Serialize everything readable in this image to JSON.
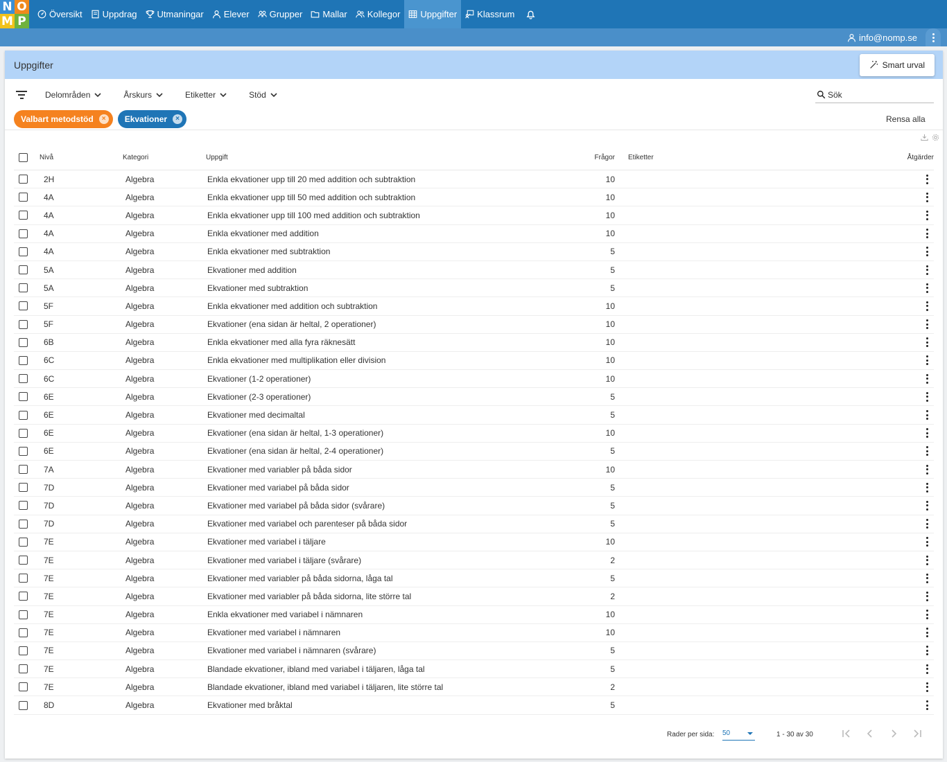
{
  "logo": {
    "letters": [
      "N",
      "O",
      "M",
      "P"
    ]
  },
  "nav": {
    "items": [
      {
        "label": "Översikt",
        "icon": "dashboard-icon",
        "active": false
      },
      {
        "label": "Uppdrag",
        "icon": "book-icon",
        "active": false
      },
      {
        "label": "Utmaningar",
        "icon": "trophy-icon",
        "active": false
      },
      {
        "label": "Elever",
        "icon": "user-icon",
        "active": false
      },
      {
        "label": "Grupper",
        "icon": "group-icon",
        "active": false
      },
      {
        "label": "Mallar",
        "icon": "folder-icon",
        "active": false
      },
      {
        "label": "Kollegor",
        "icon": "colleagues-icon",
        "active": false
      },
      {
        "label": "Uppgifter",
        "icon": "grid-icon",
        "active": true
      },
      {
        "label": "Klassrum",
        "icon": "classroom-icon",
        "active": false
      }
    ],
    "bell_icon": "bell-icon"
  },
  "user": {
    "email": "info@nomp.se"
  },
  "page": {
    "title": "Uppgifter",
    "smart_button": "Smart urval"
  },
  "filters": {
    "dropdowns": [
      "Delområden",
      "Årskurs",
      "Etiketter",
      "Stöd"
    ],
    "search_placeholder": "Sök",
    "chips": [
      {
        "label": "Valbart metodstöd",
        "color": "#f5821f"
      },
      {
        "label": "Ekvationer",
        "color": "#1f75b6"
      }
    ],
    "clear_all": "Rensa alla"
  },
  "table": {
    "headers": {
      "niva": "Nivå",
      "kategori": "Kategori",
      "uppgift": "Uppgift",
      "fragor": "Frågor",
      "etiketter": "Etiketter",
      "atgarder": "Åtgärder"
    },
    "rows": [
      {
        "niva": "2H",
        "kategori": "Algebra",
        "uppgift": "Enkla ekvationer upp till 20 med addition och subtraktion",
        "fragor": "10",
        "etiketter": ""
      },
      {
        "niva": "4A",
        "kategori": "Algebra",
        "uppgift": "Enkla ekvationer upp till 50 med addition och subtraktion",
        "fragor": "10",
        "etiketter": ""
      },
      {
        "niva": "4A",
        "kategori": "Algebra",
        "uppgift": "Enkla ekvationer upp till 100 med addition och subtraktion",
        "fragor": "10",
        "etiketter": ""
      },
      {
        "niva": "4A",
        "kategori": "Algebra",
        "uppgift": "Enkla ekvationer med addition",
        "fragor": "10",
        "etiketter": ""
      },
      {
        "niva": "4A",
        "kategori": "Algebra",
        "uppgift": "Enkla ekvationer med subtraktion",
        "fragor": "5",
        "etiketter": ""
      },
      {
        "niva": "5A",
        "kategori": "Algebra",
        "uppgift": "Ekvationer med addition",
        "fragor": "5",
        "etiketter": ""
      },
      {
        "niva": "5A",
        "kategori": "Algebra",
        "uppgift": "Ekvationer med subtraktion",
        "fragor": "5",
        "etiketter": ""
      },
      {
        "niva": "5F",
        "kategori": "Algebra",
        "uppgift": "Enkla ekvationer med addition och subtraktion",
        "fragor": "10",
        "etiketter": ""
      },
      {
        "niva": "5F",
        "kategori": "Algebra",
        "uppgift": "Ekvationer (ena sidan är heltal, 2 operationer)",
        "fragor": "10",
        "etiketter": ""
      },
      {
        "niva": "6B",
        "kategori": "Algebra",
        "uppgift": "Enkla ekvationer med alla fyra räknesätt",
        "fragor": "10",
        "etiketter": ""
      },
      {
        "niva": "6C",
        "kategori": "Algebra",
        "uppgift": "Enkla ekvationer med multiplikation eller division",
        "fragor": "10",
        "etiketter": ""
      },
      {
        "niva": "6C",
        "kategori": "Algebra",
        "uppgift": "Ekvationer (1-2 operationer)",
        "fragor": "10",
        "etiketter": ""
      },
      {
        "niva": "6E",
        "kategori": "Algebra",
        "uppgift": "Ekvationer (2-3 operationer)",
        "fragor": "5",
        "etiketter": ""
      },
      {
        "niva": "6E",
        "kategori": "Algebra",
        "uppgift": "Ekvationer med decimaltal",
        "fragor": "5",
        "etiketter": ""
      },
      {
        "niva": "6E",
        "kategori": "Algebra",
        "uppgift": "Ekvationer (ena sidan är heltal, 1-3 operationer)",
        "fragor": "10",
        "etiketter": ""
      },
      {
        "niva": "6E",
        "kategori": "Algebra",
        "uppgift": "Ekvationer (ena sidan är heltal, 2-4 operationer)",
        "fragor": "5",
        "etiketter": ""
      },
      {
        "niva": "7A",
        "kategori": "Algebra",
        "uppgift": "Ekvationer med variabler på båda sidor",
        "fragor": "10",
        "etiketter": ""
      },
      {
        "niva": "7D",
        "kategori": "Algebra",
        "uppgift": "Ekvationer med variabel på båda sidor",
        "fragor": "5",
        "etiketter": ""
      },
      {
        "niva": "7D",
        "kategori": "Algebra",
        "uppgift": "Ekvationer med variabel på båda sidor (svårare)",
        "fragor": "5",
        "etiketter": ""
      },
      {
        "niva": "7D",
        "kategori": "Algebra",
        "uppgift": "Ekvationer med variabel och parenteser på båda sidor",
        "fragor": "5",
        "etiketter": ""
      },
      {
        "niva": "7E",
        "kategori": "Algebra",
        "uppgift": "Ekvationer med variabel i täljare",
        "fragor": "10",
        "etiketter": ""
      },
      {
        "niva": "7E",
        "kategori": "Algebra",
        "uppgift": "Ekvationer med variabel i täljare (svårare)",
        "fragor": "2",
        "etiketter": ""
      },
      {
        "niva": "7E",
        "kategori": "Algebra",
        "uppgift": "Ekvationer med variabler på båda sidorna, låga tal",
        "fragor": "5",
        "etiketter": ""
      },
      {
        "niva": "7E",
        "kategori": "Algebra",
        "uppgift": "Ekvationer med variabler på båda sidorna, lite större tal",
        "fragor": "2",
        "etiketter": ""
      },
      {
        "niva": "7E",
        "kategori": "Algebra",
        "uppgift": "Enkla ekvationer med variabel i nämnaren",
        "fragor": "10",
        "etiketter": ""
      },
      {
        "niva": "7E",
        "kategori": "Algebra",
        "uppgift": "Ekvationer med variabel i nämnaren",
        "fragor": "10",
        "etiketter": ""
      },
      {
        "niva": "7E",
        "kategori": "Algebra",
        "uppgift": "Ekvationer med variabel i nämnaren (svårare)",
        "fragor": "5",
        "etiketter": ""
      },
      {
        "niva": "7E",
        "kategori": "Algebra",
        "uppgift": "Blandade ekvationer, ibland med variabel i täljaren, låga tal",
        "fragor": "5",
        "etiketter": ""
      },
      {
        "niva": "7E",
        "kategori": "Algebra",
        "uppgift": "Blandade ekvationer, ibland med variabel i täljaren, lite större tal",
        "fragor": "2",
        "etiketter": ""
      },
      {
        "niva": "8D",
        "kategori": "Algebra",
        "uppgift": "Ekvationer med bråktal",
        "fragor": "5",
        "etiketter": ""
      }
    ]
  },
  "pagination": {
    "rows_per_page_label": "Rader per sida:",
    "rows_per_page": "50",
    "range": "1 - 30 av 30"
  },
  "colors": {
    "nav": "#1f75b6",
    "nav_active": "#4a95cf",
    "subbar": "#4a8fc9",
    "header": "#b3d4f8",
    "chip_orange": "#f5821f",
    "chip_blue": "#1f75b6"
  }
}
